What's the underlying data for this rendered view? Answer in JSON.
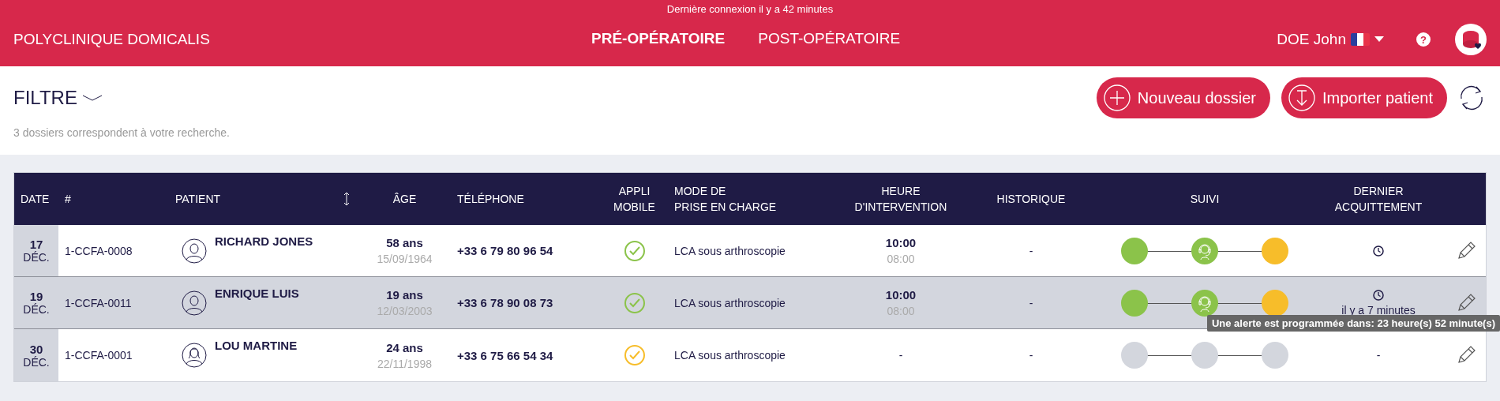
{
  "top_notice": "Dernière connexion il y a 42 minutes",
  "header": {
    "brand": "POLYCLINIQUE DOMICALIS",
    "nav": [
      {
        "label": "PRÉ-OPÉRATOIRE",
        "selected": true
      },
      {
        "label": "POST-OPÉRATOIRE",
        "selected": false
      }
    ],
    "user": "DOE John",
    "help_label": "?"
  },
  "toolbar": {
    "filter_label": "FILTRE",
    "buttons": [
      {
        "label": "Nouveau dossier",
        "kind": "add"
      },
      {
        "label": "Importer patient",
        "kind": "import"
      }
    ],
    "result_count": "3 dossiers correspondent à votre recherche."
  },
  "table": {
    "columns": [
      {
        "label": "DATE",
        "kind": "date"
      },
      {
        "label": "#",
        "kind": "id"
      },
      {
        "label": "PATIENT",
        "kind": "patient"
      },
      {
        "label": "ÂGE",
        "kind": "age"
      },
      {
        "label": "TÉLÉPHONE",
        "kind": "phone"
      },
      {
        "label": "APPLI\nMOBILE",
        "kind": "app"
      },
      {
        "label": "MODE DE\nPRISE EN CHARGE",
        "kind": "mode"
      },
      {
        "label": "HEURE\nD'INTERVENTION",
        "kind": "time"
      },
      {
        "label": "HISTORIQUE",
        "kind": "history"
      },
      {
        "label": "SUIVI",
        "kind": "follow"
      },
      {
        "label": "DERNIER\nACQUITTEMENT",
        "kind": "ack"
      }
    ],
    "rows": [
      {
        "selected": false,
        "day": "17",
        "month": "DÉC.",
        "id": "1-CCFA-0008",
        "patient": "RICHARD JONES",
        "avatar": {
          "kind": "male"
        },
        "age": "58 ans",
        "birth_date": "15/09/1964",
        "phone": "+33 6 79 80 96 54",
        "app": {
          "color": "#8bc34a"
        },
        "mode": "LCA sous arthroscopie",
        "time": "10:00",
        "time_sub": "08:00",
        "history": "-",
        "follow": [
          {
            "kind": "dot",
            "color": "#8bc34a"
          },
          {
            "kind": "headset",
            "color": "#8bc34a"
          },
          {
            "kind": "dot",
            "color": "#f7bd2a"
          }
        ],
        "ack": {
          "clock": true
        }
      },
      {
        "selected": true,
        "day": "19",
        "month": "DÉC.",
        "id": "1-CCFA-0011",
        "patient": "ENRIQUE LUIS",
        "avatar": {
          "kind": "male"
        },
        "age": "19 ans",
        "birth_date": "12/03/2003",
        "phone": "+33 6 78 90 08 73",
        "app": {
          "color": "#8bc34a"
        },
        "mode": "LCA sous arthroscopie",
        "time": "10:00",
        "time_sub": "08:00",
        "history": "-",
        "follow": [
          {
            "kind": "dot",
            "color": "#8bc34a"
          },
          {
            "kind": "headset",
            "color": "#8bc34a"
          },
          {
            "kind": "dot",
            "color": "#f7bd2a"
          }
        ],
        "ack": {
          "clock": true,
          "text": "il y a 7 minutes"
        }
      },
      {
        "selected": false,
        "day": "30",
        "month": "DÉC.",
        "id": "1-CCFA-0001",
        "patient": "LOU MARTINE",
        "avatar": {
          "kind": "female"
        },
        "age": "24 ans",
        "birth_date": "22/11/1998",
        "phone": "+33 6 75 66 54 34",
        "app": {
          "color": "#f7bd2a"
        },
        "mode": "LCA sous arthroscopie",
        "time": "-",
        "history": "-",
        "follow": [
          {
            "kind": "dot",
            "color": "#d3d6dd"
          },
          {
            "kind": "dot",
            "color": "#d3d6dd"
          },
          {
            "kind": "dot",
            "color": "#d3d6dd"
          }
        ],
        "ack": {
          "clock": false,
          "text": "-"
        }
      }
    ]
  },
  "tooltip": "Une alerte est programmée dans: 23 heure(s) 52 minute(s)"
}
